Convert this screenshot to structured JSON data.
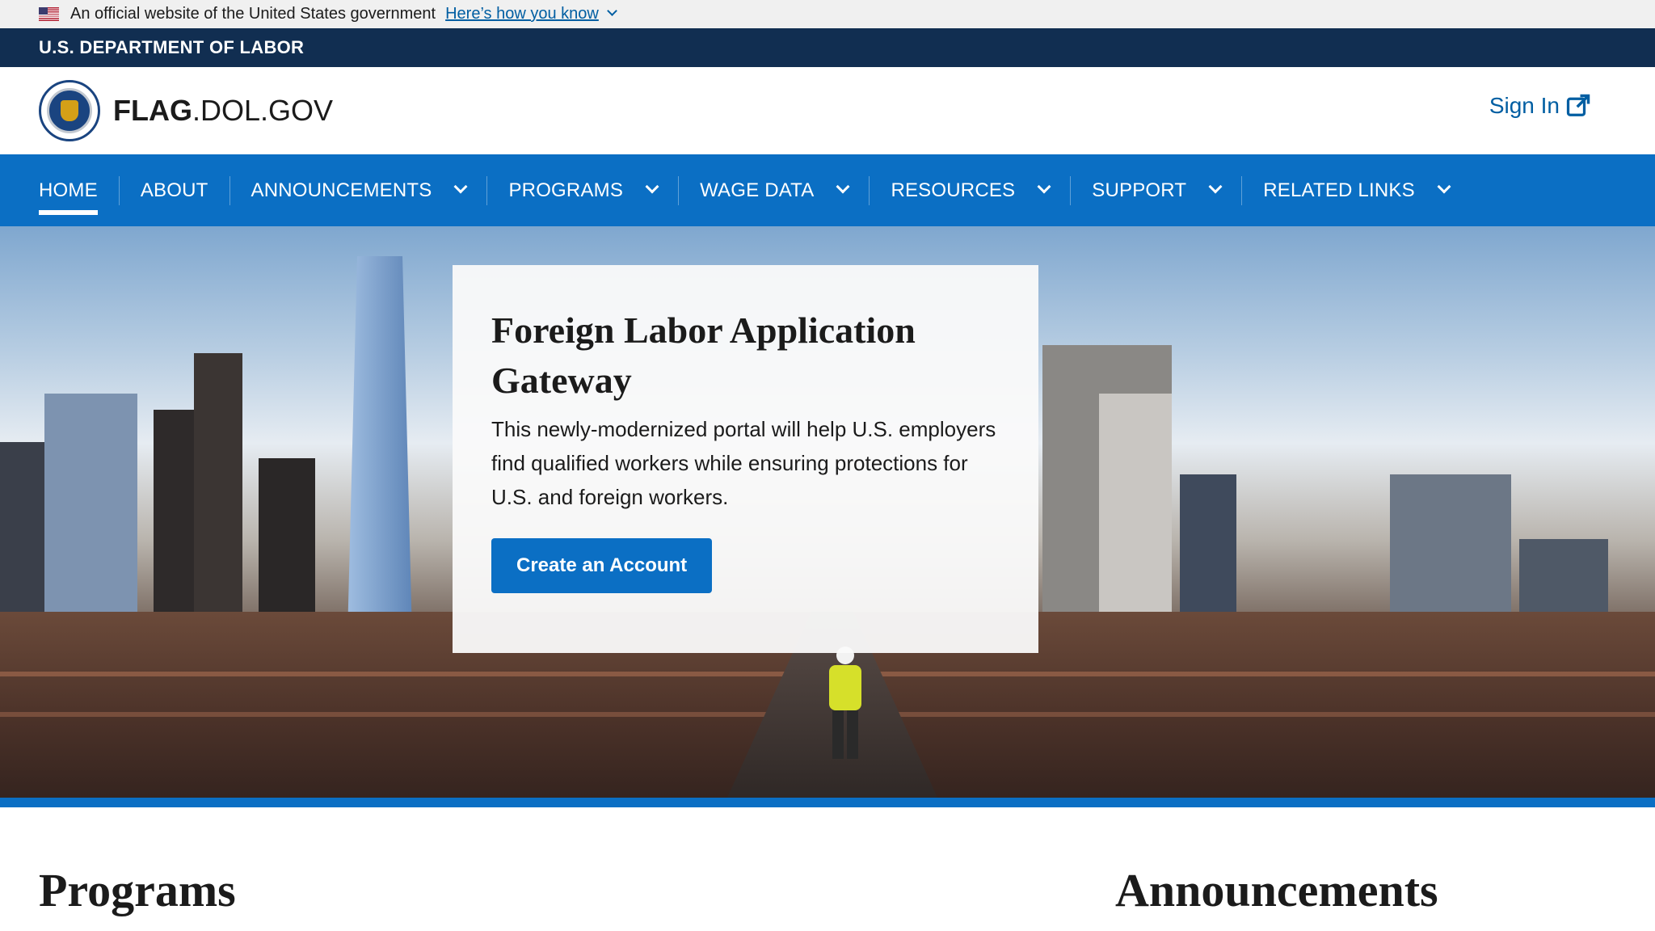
{
  "gov_banner": {
    "text": "An official website of the United States government",
    "link": "Here’s how you know"
  },
  "agency_bar": {
    "label": "U.S. DEPARTMENT OF LABOR"
  },
  "header": {
    "site_title_bold": "FLAG",
    "site_title_rest": ".DOL.GOV",
    "sign_in": "Sign In"
  },
  "nav": {
    "items": [
      {
        "label": "HOME",
        "dropdown": false,
        "active": true
      },
      {
        "label": "ABOUT",
        "dropdown": false
      },
      {
        "label": "ANNOUNCEMENTS",
        "dropdown": true
      },
      {
        "label": "PROGRAMS",
        "dropdown": true
      },
      {
        "label": "WAGE DATA",
        "dropdown": true
      },
      {
        "label": "RESOURCES",
        "dropdown": true
      },
      {
        "label": "SUPPORT",
        "dropdown": true
      },
      {
        "label": "RELATED LINKS",
        "dropdown": true
      }
    ]
  },
  "hero": {
    "title": "Foreign Labor Application Gateway",
    "description": "This newly-modernized portal will help U.S. employers find qualified workers while ensuring protections for U.S. and foreign workers.",
    "cta": "Create an Account"
  },
  "sections": {
    "programs": "Programs",
    "announcements": "Announcements"
  },
  "colors": {
    "nav_blue": "#0b6fc4",
    "agency_navy": "#112e51",
    "link_blue": "#005ea2"
  }
}
